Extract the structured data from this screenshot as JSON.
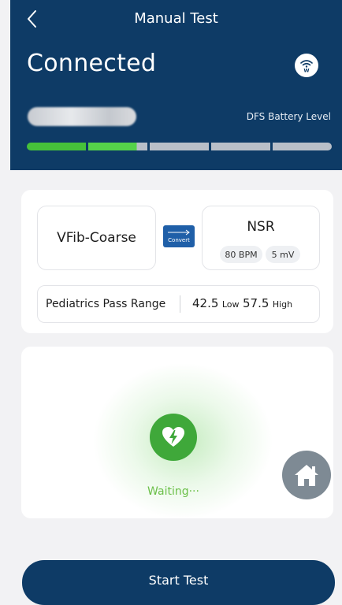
{
  "header": {
    "title": "Manual Test",
    "status": "Connected",
    "battery_label": "DFS Battery Level",
    "battery_level": 0.4,
    "battery_segments": 5
  },
  "config": {
    "from_rhythm": "VFib-Coarse",
    "convert_label": "Convert",
    "to_rhythm": "NSR",
    "to_bpm": "80 BPM",
    "to_mv": "5 mV",
    "range_label": "Pediatrics Pass Range",
    "range_low_value": "42.5",
    "range_low_label": "Low",
    "range_high_value": "57.5",
    "range_high_label": "High"
  },
  "test": {
    "status": "Waiting···"
  },
  "actions": {
    "start_label": "Start Test"
  },
  "colors": {
    "primary": "#0e3b66",
    "accent_green": "#3fa83a",
    "battery_green": "#46c13a"
  },
  "icons": [
    "back-icon",
    "wifi-icon",
    "convert-icon",
    "heart-bolt-icon",
    "home-icon"
  ]
}
